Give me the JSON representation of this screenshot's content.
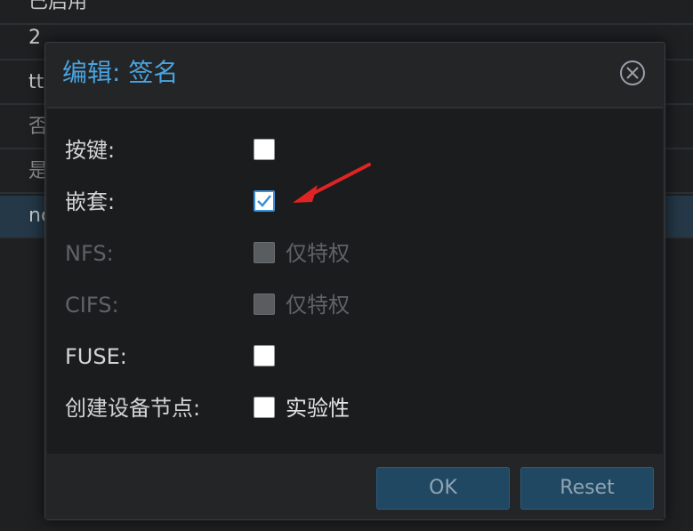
{
  "background_rows": [
    {
      "text": "已启用"
    },
    {
      "text": "2"
    },
    {
      "text": "tt"
    },
    {
      "text": "否"
    },
    {
      "text": "是"
    },
    {
      "text": "nc"
    }
  ],
  "dialog": {
    "title": "编辑: 签名",
    "close_icon": "close-icon",
    "fields": [
      {
        "label": "按键:",
        "checked": false,
        "disabled": false,
        "box_label": ""
      },
      {
        "label": "嵌套:",
        "checked": true,
        "disabled": false,
        "box_label": ""
      },
      {
        "label": "NFS:",
        "checked": false,
        "disabled": true,
        "box_label": "仅特权"
      },
      {
        "label": "CIFS:",
        "checked": false,
        "disabled": true,
        "box_label": "仅特权"
      },
      {
        "label": "FUSE:",
        "checked": false,
        "disabled": false,
        "box_label": ""
      },
      {
        "label": "创建设备节点:",
        "checked": false,
        "disabled": false,
        "box_label": "实验性"
      }
    ],
    "buttons": {
      "ok": "OK",
      "reset": "Reset"
    }
  },
  "colors": {
    "accent": "#4aa3e0",
    "annotation_arrow": "#e02424",
    "button_bg": "#214863"
  }
}
